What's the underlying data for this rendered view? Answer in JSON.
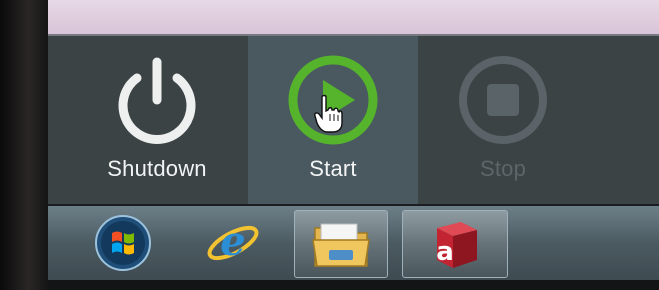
{
  "command_bar": {
    "shutdown": {
      "label": "Shutdown",
      "icon": "power-icon"
    },
    "start": {
      "label": "Start",
      "icon": "play-icon",
      "cursor": "hand-cursor-icon"
    },
    "stop": {
      "label": "Stop",
      "icon": "stop-icon"
    }
  },
  "taskbar": {
    "items": [
      {
        "name": "windows-start-orb",
        "icon": "windows-logo-icon"
      },
      {
        "name": "internet-explorer",
        "icon": "ie-icon"
      },
      {
        "name": "windows-explorer",
        "icon": "folder-icon"
      },
      {
        "name": "app-a",
        "icon": "cube-a-icon",
        "glyph": "a"
      }
    ]
  },
  "colors": {
    "start_green": "#55b32c",
    "command_bar_bg": "#3b4345",
    "start_hover_bg": "#4a5860",
    "disabled_gray": "#5c666a"
  }
}
